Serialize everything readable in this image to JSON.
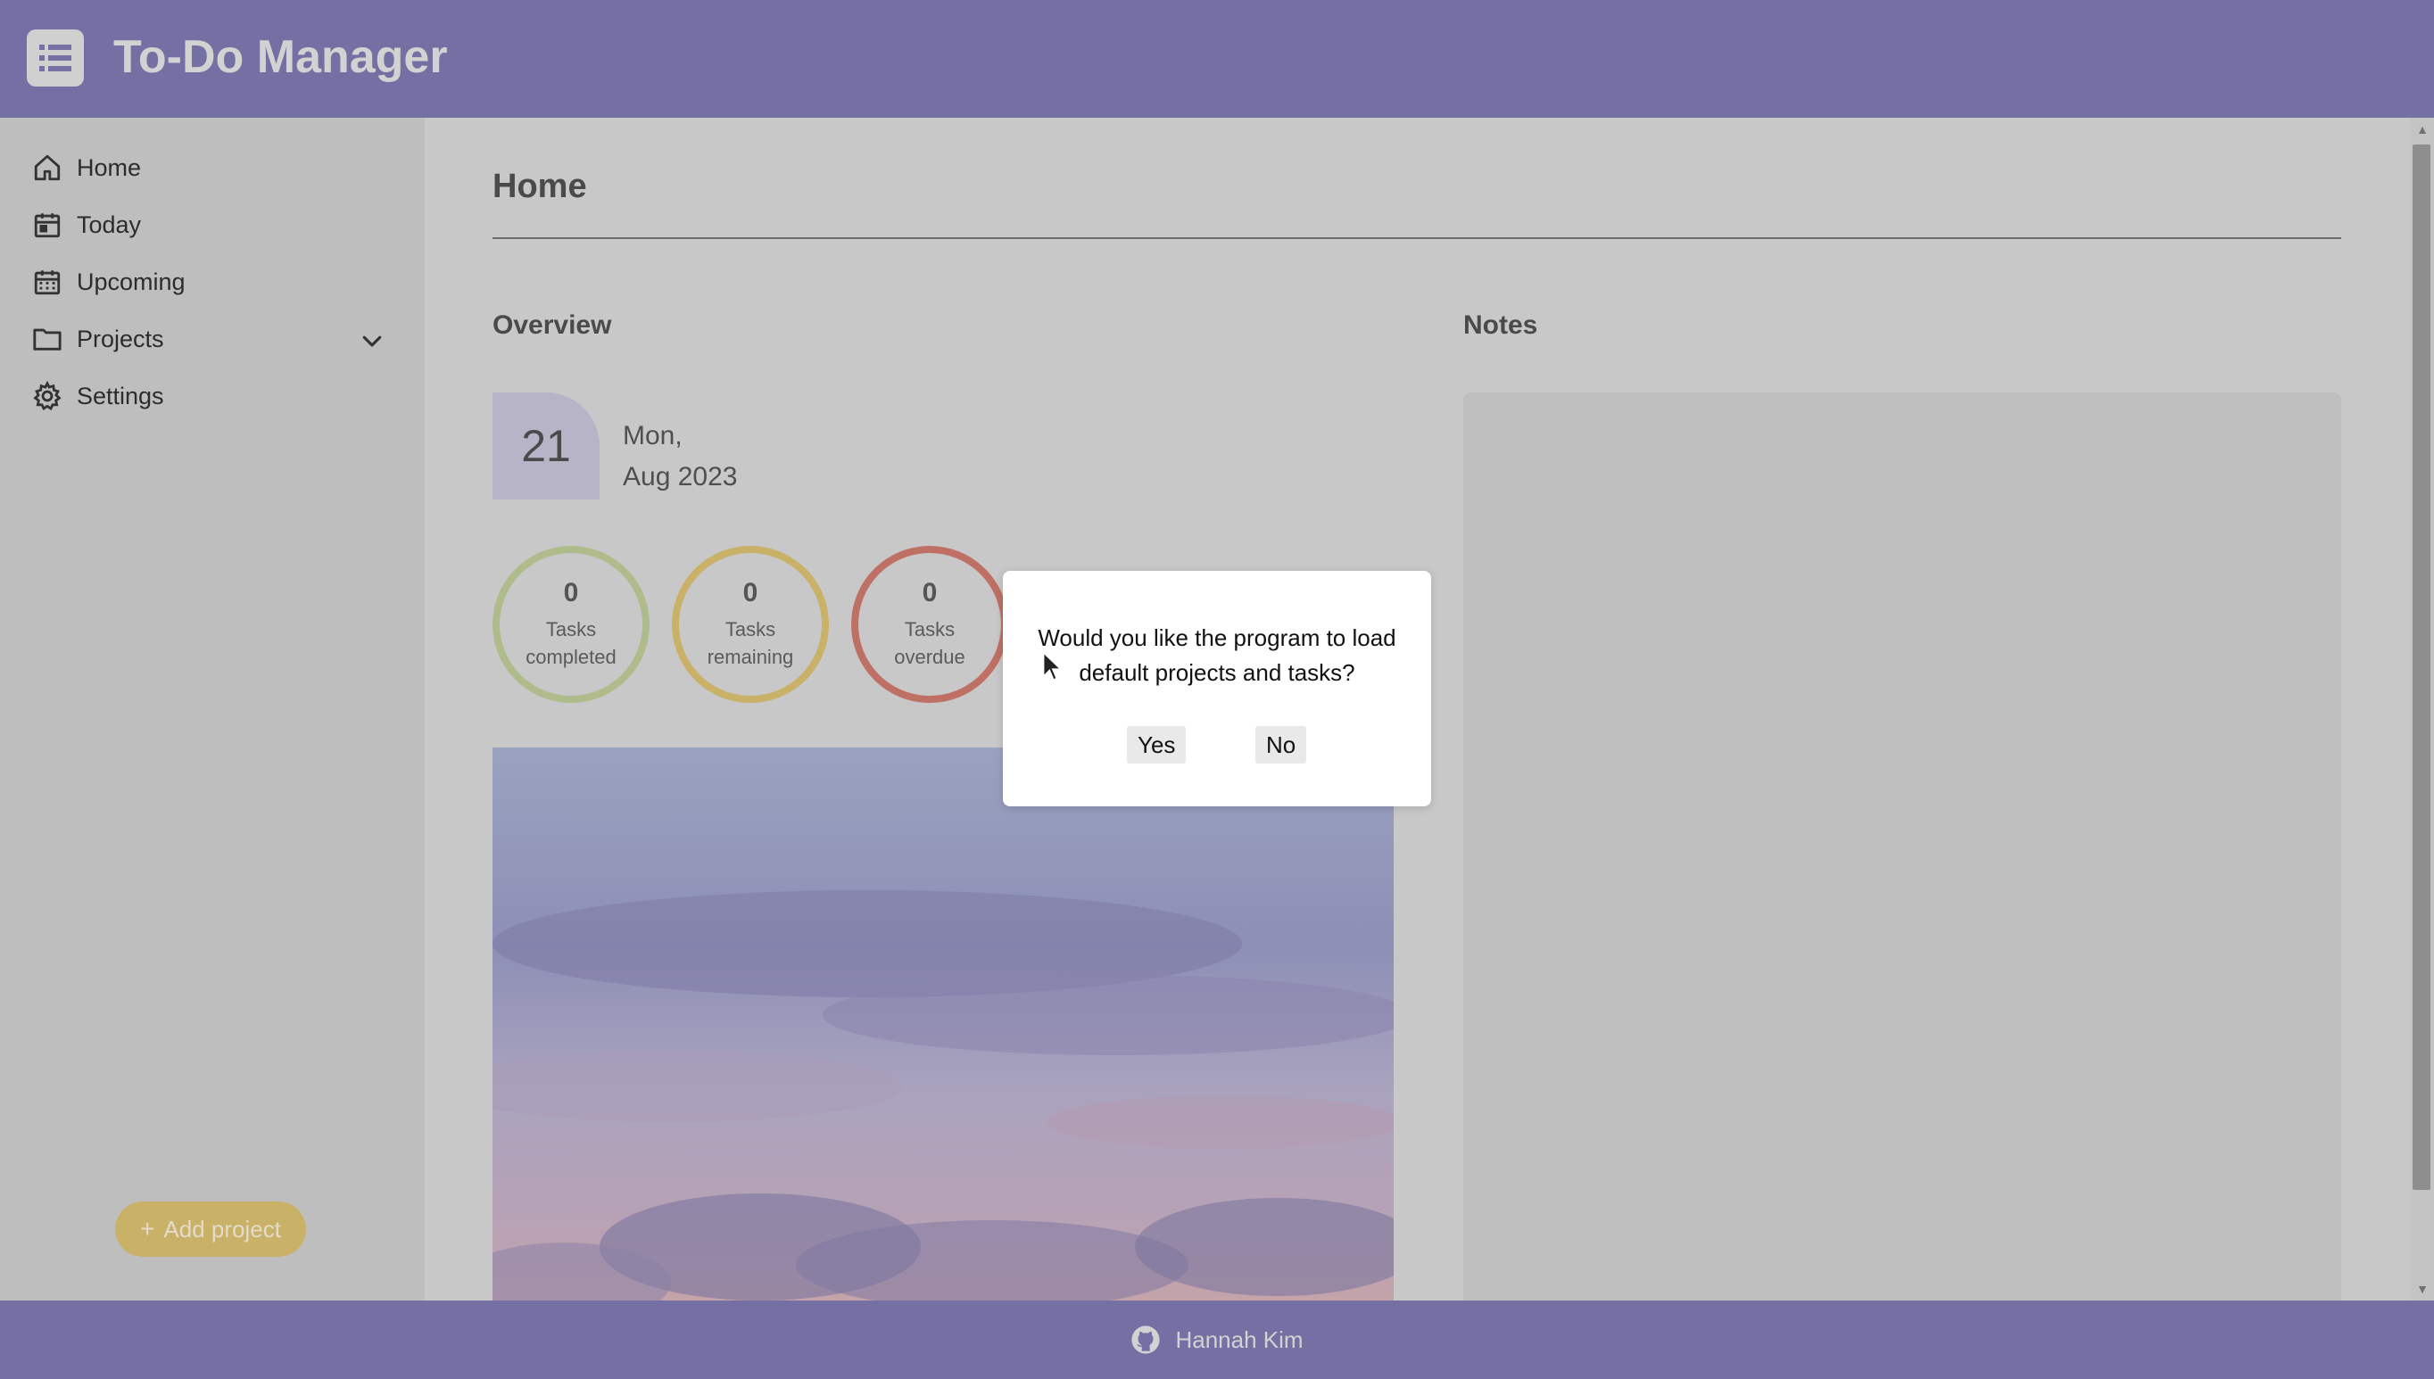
{
  "app": {
    "title": "To-Do Manager"
  },
  "colors": {
    "header_bg": "#7470a3",
    "sidebar_bg": "#bebebe",
    "main_bg": "#c8c8c8",
    "accent_yellow": "#c9b167",
    "completed_ring": "#b0bb8c",
    "remaining_ring": "#c9b167",
    "overdue_ring": "#bf7065"
  },
  "sidebar": {
    "items": [
      {
        "label": "Home",
        "icon": "home-icon"
      },
      {
        "label": "Today",
        "icon": "calendar-day-icon"
      },
      {
        "label": "Upcoming",
        "icon": "calendar-grid-icon"
      },
      {
        "label": "Projects",
        "icon": "folder-icon"
      },
      {
        "label": "Settings",
        "icon": "gear-icon"
      }
    ],
    "add_project_label": "Add project",
    "add_project_icon": "plus-icon"
  },
  "main": {
    "page_title": "Home",
    "overview_heading": "Overview",
    "notes_heading": "Notes",
    "date": {
      "day": "21",
      "weekday": "Mon,",
      "month_year": "Aug 2023"
    },
    "stats": [
      {
        "count": "0",
        "label": "Tasks completed"
      },
      {
        "count": "0",
        "label": "Tasks remaining"
      },
      {
        "count": "0",
        "label": "Tasks overdue"
      }
    ]
  },
  "dialog": {
    "message": "Would you like the program to load default projects and tasks?",
    "yes_label": "Yes",
    "no_label": "No"
  },
  "footer": {
    "author": "Hannah Kim",
    "icon": "github-icon"
  }
}
